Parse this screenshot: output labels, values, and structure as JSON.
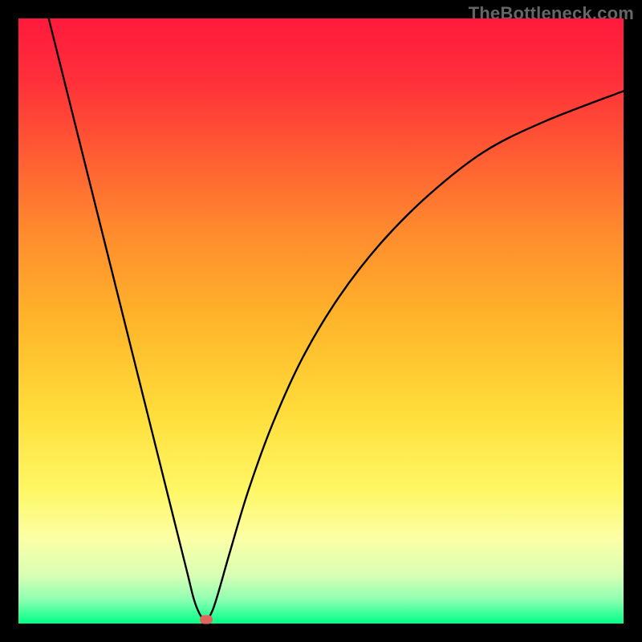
{
  "watermark": "TheBottleneck.com",
  "colors": {
    "frame": "#000000",
    "curve": "#000000",
    "marker": "#e06659",
    "gradient_stops": [
      {
        "offset": 0.0,
        "color": "#ff1a3d"
      },
      {
        "offset": 0.1,
        "color": "#ff2f3a"
      },
      {
        "offset": 0.22,
        "color": "#ff5a33"
      },
      {
        "offset": 0.35,
        "color": "#ff8a2e"
      },
      {
        "offset": 0.5,
        "color": "#ffb52a"
      },
      {
        "offset": 0.65,
        "color": "#ffdd3a"
      },
      {
        "offset": 0.78,
        "color": "#fff765"
      },
      {
        "offset": 0.86,
        "color": "#fbffa6"
      },
      {
        "offset": 0.92,
        "color": "#d8ffb4"
      },
      {
        "offset": 0.96,
        "color": "#8fffb2"
      },
      {
        "offset": 1.0,
        "color": "#00ff88"
      }
    ]
  },
  "chart_data": {
    "type": "line",
    "title": "",
    "xlabel": "",
    "ylabel": "",
    "xlim": [
      0,
      100
    ],
    "ylim": [
      0,
      100
    ],
    "x": [
      5,
      7,
      9,
      11,
      13,
      15,
      17,
      19,
      21,
      23,
      25,
      27,
      28,
      29,
      30,
      31,
      32,
      33,
      35,
      38,
      42,
      47,
      53,
      60,
      68,
      77,
      87,
      100
    ],
    "y": [
      100,
      92,
      84,
      76,
      68,
      60,
      52,
      44,
      36,
      28,
      20,
      12,
      8,
      4,
      1.5,
      0.5,
      2,
      5,
      12,
      22,
      33,
      44,
      54,
      63,
      71,
      78,
      83,
      88
    ],
    "marker": {
      "x": 31,
      "y": 0.7
    },
    "annotations": []
  }
}
